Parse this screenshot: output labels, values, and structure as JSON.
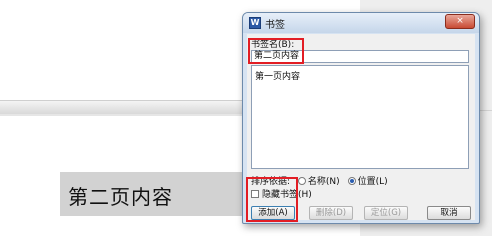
{
  "document": {
    "heading_text": "第二页内容"
  },
  "dialog": {
    "title": "书签",
    "icon_glyph": "W",
    "close_glyph": "×",
    "name_label": "书签名(B):",
    "name_value": "第二页内容",
    "bookmarks": [
      "第一页内容"
    ],
    "sort_label": "排序依据:",
    "sort_options": [
      {
        "label": "名称(N)",
        "selected": false
      },
      {
        "label": "位置(L)",
        "selected": true
      }
    ],
    "hide_label": "隐藏书签(H)",
    "buttons": {
      "add": "添加(A)",
      "delete": "删除(D)",
      "locate": "定位(G)",
      "cancel": "取消"
    }
  },
  "colors": {
    "highlight": "#e21d24",
    "titlebar": "#c5d6ea",
    "close_button": "#c84a33"
  }
}
